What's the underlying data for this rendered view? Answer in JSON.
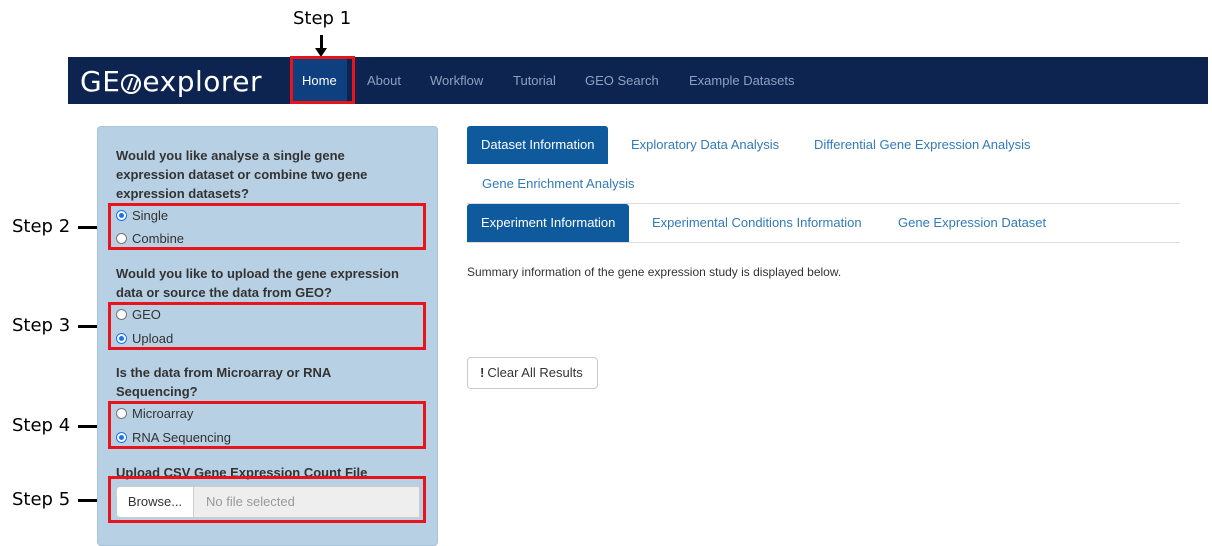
{
  "annotations": {
    "step1": "Step 1",
    "step2": "Step 2",
    "step3": "Step 3",
    "step4": "Step 4",
    "step5": "Step 5"
  },
  "navbar": {
    "brand_prefix": "GE",
    "brand_suffix": "explorer",
    "items": [
      "Home",
      "About",
      "Workflow",
      "Tutorial",
      "GEO Search",
      "Example Datasets"
    ],
    "active": "Home"
  },
  "sidebar": {
    "q1": "Would you like analyse a single gene expression dataset or combine two gene expression datasets?",
    "q1_options": [
      {
        "label": "Single",
        "selected": true
      },
      {
        "label": "Combine",
        "selected": false
      }
    ],
    "q2": "Would you like to upload the gene expression data or source the data from GEO?",
    "q2_options": [
      {
        "label": "GEO",
        "selected": false
      },
      {
        "label": "Upload",
        "selected": true
      }
    ],
    "q3": "Is the data from Microarray or RNA Sequencing?",
    "q3_options": [
      {
        "label": "Microarray",
        "selected": false
      },
      {
        "label": "RNA Sequencing",
        "selected": true
      }
    ],
    "upload_label": "Upload CSV Gene Expression Count File",
    "browse_label": "Browse...",
    "file_placeholder": "No file selected"
  },
  "main": {
    "tabs": [
      "Dataset Information",
      "Exploratory Data Analysis",
      "Differential Gene Expression Analysis",
      "Gene Enrichment Analysis"
    ],
    "active_tab": "Dataset Information",
    "subtabs": [
      "Experiment Information",
      "Experimental Conditions Information",
      "Gene Expression Dataset"
    ],
    "active_subtab": "Experiment Information",
    "summary": "Summary information of the gene expression study is displayed below.",
    "clear_button": "Clear All Results"
  },
  "colors": {
    "navbar_bg": "#0d2451",
    "nav_active_bg": "#0e3f7e",
    "sidebar_bg": "#b7d0e3",
    "tab_active_bg": "#0e5a9c",
    "link": "#337ab7",
    "highlight": "#e8141b"
  }
}
